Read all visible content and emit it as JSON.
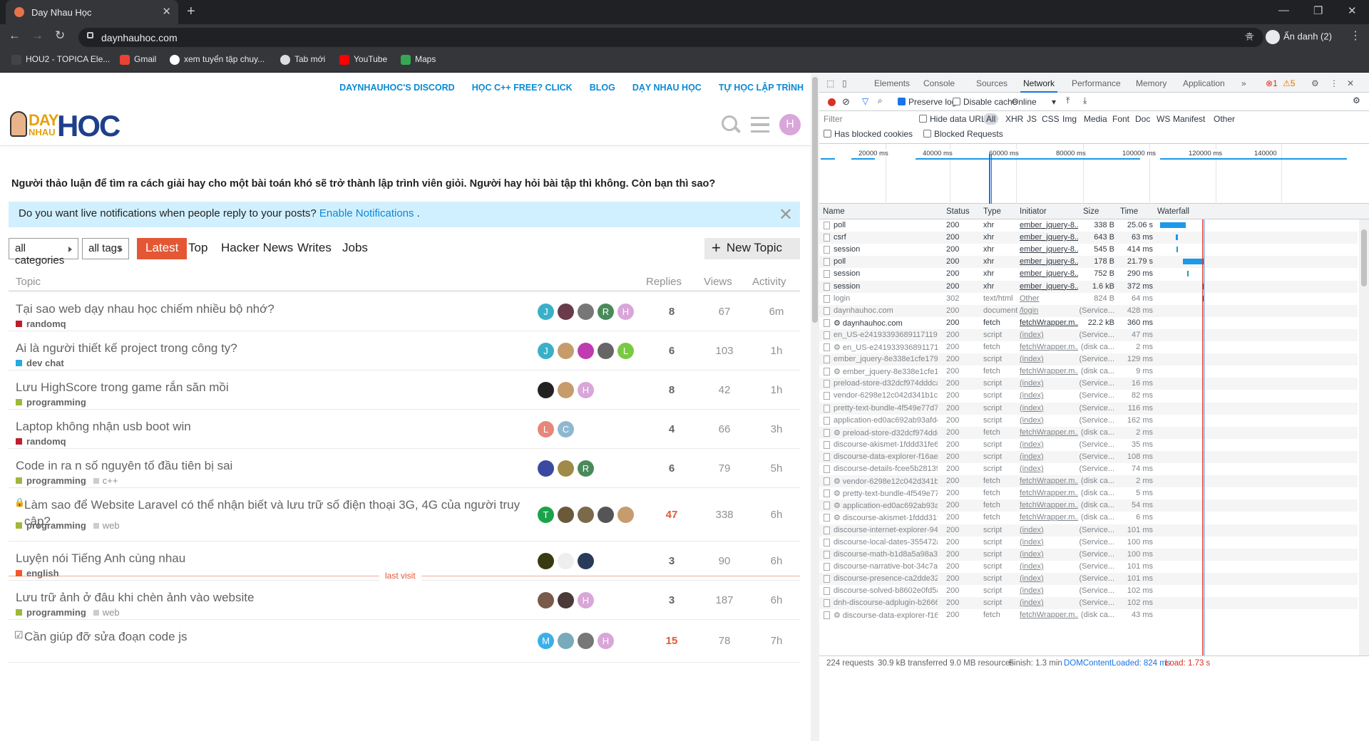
{
  "browser": {
    "tab_title": "Day Nhau Học",
    "url": "daynhauhoc.com",
    "profile": "Ẩn danh (2)",
    "bookmarks": [
      "HOU2 - TOPICA Ele...",
      "Gmail",
      "xem tuyển tập chuy...",
      "Tab mới",
      "YouTube",
      "Maps"
    ]
  },
  "site": {
    "top_links": [
      "DAYNHAUHOC'S DISCORD",
      "HỌC C++ FREE? CLICK",
      "BLOG",
      "DẠY NHAU HỌC",
      "TỰ HỌC LẬP TRÌNH"
    ],
    "logo": {
      "day": "DAY",
      "nhau": "NHAU",
      "hoc": "HOC"
    },
    "user_initial": "H",
    "tagline": "Người thảo luận để tìm ra cách giải hay cho một bài toán khó sẽ trở thành lập trình viên giỏi. Người hay hỏi bài tập thì không. Còn bạn thì sao?",
    "notice": "Do you want live notifications when people reply to your posts?",
    "notice_link": "Enable Notifications",
    "notice_tail": ".",
    "filters": {
      "categories": "all categories",
      "tags": "all tags"
    },
    "nav": [
      "Latest",
      "Top",
      "Hacker News",
      "Writes",
      "Jobs"
    ],
    "new_topic": "New Topic",
    "columns": {
      "topic": "Topic",
      "replies": "Replies",
      "views": "Views",
      "activity": "Activity"
    },
    "last_visit": "last visit",
    "topics": [
      {
        "title": "Tại sao web dạy nhau học chiếm nhiều bộ nhớ?",
        "category": "randomq",
        "cat_color": "#bf1e2e",
        "tags": [],
        "posters": [
          "J",
          "",
          "",
          "R",
          "H"
        ],
        "poster_colors": [
          "#3ab0c8",
          "#6a3b4a",
          "#777",
          "#4a8a5a",
          "#d9a6d9"
        ],
        "replies": "8",
        "views": "67",
        "activity": "6m"
      },
      {
        "title": "Ai là người thiết kế project trong công ty?",
        "category": "dev chat",
        "cat_color": "#25aae2",
        "tags": [],
        "posters": [
          "J",
          "",
          "",
          "",
          "L"
        ],
        "poster_colors": [
          "#3ab0c8",
          "#c69c6d",
          "#c03ab0",
          "#666",
          "#7ac943"
        ],
        "replies": "6",
        "views": "103",
        "activity": "1h"
      },
      {
        "title": "Lưu HighScore trong game rắn săn mồi",
        "category": "programming",
        "cat_color": "#9eb83b",
        "tags": [],
        "posters": [
          "",
          "",
          "H"
        ],
        "poster_colors": [
          "#222",
          "#c69c6d",
          "#d9a6d9"
        ],
        "replies": "8",
        "views": "42",
        "activity": "1h"
      },
      {
        "title": "Laptop không nhận usb boot win",
        "category": "randomq",
        "cat_color": "#bf1e2e",
        "tags": [],
        "posters": [
          "L",
          "C"
        ],
        "poster_colors": [
          "#e6877a",
          "#8fb8d0"
        ],
        "replies": "4",
        "views": "66",
        "activity": "3h"
      },
      {
        "title": "Code in ra n số nguyên tố đầu tiên bị sai",
        "category": "programming",
        "cat_color": "#9eb83b",
        "tags": [
          "c++"
        ],
        "posters": [
          "",
          "",
          "R"
        ],
        "poster_colors": [
          "#3a4aa0",
          "#a08a4a",
          "#4a8a5a"
        ],
        "replies": "6",
        "views": "79",
        "activity": "5h"
      },
      {
        "title": "Làm sao để Website Laravel có thể nhận biết và lưu trữ số điện thoại 3G, 4G của người truy cập?",
        "category": "programming",
        "cat_color": "#9eb83b",
        "tags": [
          "web"
        ],
        "posters": [
          "T",
          "",
          "",
          "",
          ""
        ],
        "poster_colors": [
          "#1aa34a",
          "#6a5a3a",
          "#7a6a4a",
          "#555",
          "#c69c6d"
        ],
        "replies": "47",
        "views": "338",
        "activity": "6h",
        "locked": true,
        "hot": true
      },
      {
        "title": "Luyện nói Tiếng Anh cùng nhau",
        "category": "english",
        "cat_color": "#f1592a",
        "tags": [],
        "posters": [
          "",
          "",
          ""
        ],
        "poster_colors": [
          "#3a3a10",
          "#eee",
          "#2a3a5a"
        ],
        "replies": "3",
        "views": "90",
        "activity": "6h"
      },
      {
        "title": "Lưu trữ ảnh ở đâu khi chèn ảnh vào website",
        "category": "programming",
        "cat_color": "#9eb83b",
        "tags": [
          "web"
        ],
        "posters": [
          "",
          "",
          "H"
        ],
        "poster_colors": [
          "#7a5a4a",
          "#4a3a3a",
          "#d9a6d9"
        ],
        "replies": "3",
        "views": "187",
        "activity": "6h"
      },
      {
        "title": "Cần giúp đỡ sửa đoạn code js",
        "category": "",
        "cat_color": "#9eb83b",
        "tags": [],
        "posters": [
          "M",
          "",
          "",
          "H"
        ],
        "poster_colors": [
          "#3ab0e8",
          "#7ab",
          "#777",
          "#d9a6d9"
        ],
        "replies": "15",
        "views": "78",
        "activity": "7h",
        "checked": true,
        "hot": true
      }
    ]
  },
  "devtools": {
    "tabs": [
      "Elements",
      "Console",
      "Sources",
      "Network",
      "Performance",
      "Memory",
      "Application"
    ],
    "active_tab": "Network",
    "errors": "1",
    "warnings": "5",
    "preserve_log": "Preserve log",
    "disable_cache": "Disable cache",
    "throttle": "Online",
    "filter_placeholder": "Filter",
    "hide_data_urls": "Hide data URLs",
    "types": [
      "All",
      "XHR",
      "JS",
      "CSS",
      "Img",
      "Media",
      "Font",
      "Doc",
      "WS",
      "Manifest",
      "Other"
    ],
    "has_blocked_cookies": "Has blocked cookies",
    "blocked_requests": "Blocked Requests",
    "timeline_ticks": [
      "20000 ms",
      "40000 ms",
      "60000 ms",
      "80000 ms",
      "100000 ms",
      "120000 ms",
      "140000"
    ],
    "columns": [
      "Name",
      "Status",
      "Type",
      "Initiator",
      "Size",
      "Time",
      "Waterfall"
    ],
    "requests": [
      [
        "poll",
        "200",
        "xhr",
        "ember_jquery-8...",
        "338 B",
        "25.06 s"
      ],
      [
        "csrf",
        "200",
        "xhr",
        "ember_jquery-8...",
        "643 B",
        "63 ms"
      ],
      [
        "session",
        "200",
        "xhr",
        "ember_jquery-8...",
        "545 B",
        "414 ms"
      ],
      [
        "poll",
        "200",
        "xhr",
        "ember_jquery-8...",
        "178 B",
        "21.79 s"
      ],
      [
        "session",
        "200",
        "xhr",
        "ember_jquery-8...",
        "752 B",
        "290 ms"
      ],
      [
        "session",
        "200",
        "xhr",
        "ember_jquery-8...",
        "1.6 kB",
        "372 ms"
      ],
      [
        "login",
        "302",
        "text/html",
        "Other",
        "824 B",
        "64 ms"
      ],
      [
        "daynhauhoc.com",
        "200",
        "document",
        "/login",
        "(Service...",
        "428 ms"
      ],
      [
        "⚙ daynhauhoc.com",
        "200",
        "fetch",
        "fetchWrapper.m...",
        "22.2 kB",
        "360 ms"
      ],
      [
        "en_US-e24193393689117119311...",
        "200",
        "script",
        "(index)",
        "(Service...",
        "47 ms"
      ],
      [
        "⚙ en_US-e241933936891171193...",
        "200",
        "fetch",
        "fetchWrapper.m...",
        "(disk ca...",
        "2 ms"
      ],
      [
        "ember_jquery-8e338e1cfe17986...",
        "200",
        "script",
        "(index)",
        "(Service...",
        "129 ms"
      ],
      [
        "⚙ ember_jquery-8e338e1cfe179...",
        "200",
        "fetch",
        "fetchWrapper.m...",
        "(disk ca...",
        "9 ms"
      ],
      [
        "preload-store-d32dcf974dddcac...",
        "200",
        "script",
        "(index)",
        "(Service...",
        "16 ms"
      ],
      [
        "vendor-6298e12c042d341b1c8a...",
        "200",
        "script",
        "(index)",
        "(Service...",
        "82 ms"
      ],
      [
        "pretty-text-bundle-4f549e77d75...",
        "200",
        "script",
        "(index)",
        "(Service...",
        "116 ms"
      ],
      [
        "application-ed0ac692ab93afd41...",
        "200",
        "script",
        "(index)",
        "(Service...",
        "162 ms"
      ],
      [
        "⚙ preload-store-d32dcf974dddc...",
        "200",
        "fetch",
        "fetchWrapper.m...",
        "(disk ca...",
        "2 ms"
      ],
      [
        "discourse-akismet-1fddd31fe6c9...",
        "200",
        "script",
        "(index)",
        "(Service...",
        "35 ms"
      ],
      [
        "discourse-data-explorer-f16aed9...",
        "200",
        "script",
        "(index)",
        "(Service...",
        "108 ms"
      ],
      [
        "discourse-details-fcee5b28139d...",
        "200",
        "script",
        "(index)",
        "(Service...",
        "74 ms"
      ],
      [
        "⚙ vendor-6298e12c042d341b1c...",
        "200",
        "fetch",
        "fetchWrapper.m...",
        "(disk ca...",
        "2 ms"
      ],
      [
        "⚙ pretty-text-bundle-4f549e77d...",
        "200",
        "fetch",
        "fetchWrapper.m...",
        "(disk ca...",
        "5 ms"
      ],
      [
        "⚙ application-ed0ac692ab93afd...",
        "200",
        "fetch",
        "fetchWrapper.m...",
        "(disk ca...",
        "54 ms"
      ],
      [
        "⚙ discourse-akismet-1fddd31fe...",
        "200",
        "fetch",
        "fetchWrapper.m...",
        "(disk ca...",
        "6 ms"
      ],
      [
        "discourse-internet-explorer-94a...",
        "200",
        "script",
        "(index)",
        "(Service...",
        "101 ms"
      ],
      [
        "discourse-local-dates-355472ab...",
        "200",
        "script",
        "(index)",
        "(Service...",
        "100 ms"
      ],
      [
        "discourse-math-b1d8a5a98a32f...",
        "200",
        "script",
        "(index)",
        "(Service...",
        "100 ms"
      ],
      [
        "discourse-narrative-bot-34c7a69...",
        "200",
        "script",
        "(index)",
        "(Service...",
        "101 ms"
      ],
      [
        "discourse-presence-ca2dde324a...",
        "200",
        "script",
        "(index)",
        "(Service...",
        "101 ms"
      ],
      [
        "discourse-solved-b8602e0fd5a5...",
        "200",
        "script",
        "(index)",
        "(Service...",
        "102 ms"
      ],
      [
        "dnh-discourse-adplugin-b26668...",
        "200",
        "script",
        "(index)",
        "(Service...",
        "102 ms"
      ],
      [
        "⚙ discourse-data-explorer-f16ae...",
        "200",
        "fetch",
        "fetchWrapper.m...",
        "(disk ca...",
        "43 ms"
      ]
    ],
    "status": {
      "requests": "224 requests",
      "transferred": "30.9 kB transferred",
      "resources": "9.0 MB resources",
      "finish": "Finish: 1.3 min",
      "dcl": "DOMContentLoaded: 824 ms",
      "load": "Load: 1.73 s"
    }
  }
}
